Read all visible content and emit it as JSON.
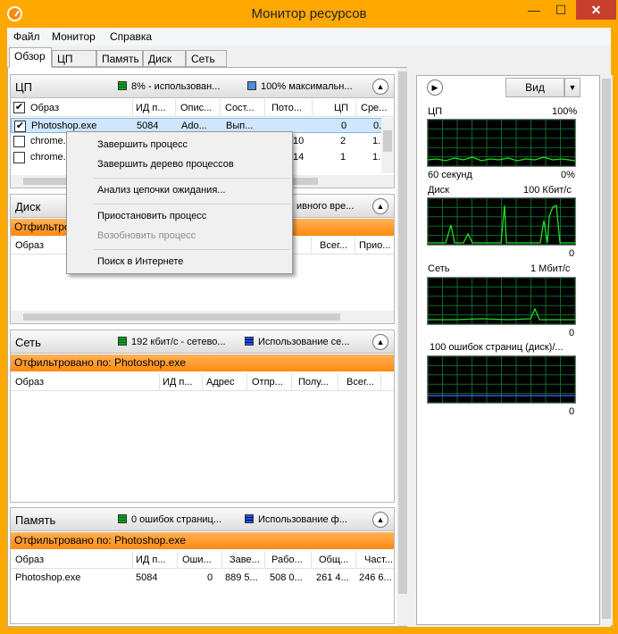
{
  "window": {
    "title": "Монитор ресурсов",
    "min_glyph": "—",
    "max_glyph": "☐",
    "close_glyph": "✕",
    "accent": "#ffa800"
  },
  "menu": [
    "Файл",
    "Монитор",
    "Справка"
  ],
  "tabs": [
    "Обзор",
    "ЦП",
    "Память",
    "Диск",
    "Сеть"
  ],
  "cpu_panel": {
    "title": "ЦП",
    "legend1": "8% - использован...",
    "legend2": "100% максимальн...",
    "columns": [
      "Образ",
      "ИД п...",
      "Опис...",
      "Сост...",
      "Пото...",
      "ЦП",
      "Сре..."
    ],
    "rows": [
      {
        "image": "Photoshop.exe",
        "pid": "5084",
        "desc": "Ado...",
        "status": "Вып...",
        "threads": "",
        "cpu": "0",
        "avg": "0...",
        "checked": true
      },
      {
        "image": "chrome.",
        "pid": "",
        "desc": "",
        "status": "",
        "threads": "10",
        "cpu": "2",
        "avg": "1.",
        "checked": false
      },
      {
        "image": "chrome.",
        "pid": "",
        "desc": "",
        "status": "",
        "threads": "14",
        "cpu": "1",
        "avg": "1.",
        "checked": false
      }
    ],
    "check_glyph": "✔"
  },
  "disk_panel": {
    "title": "Диск",
    "legend2": "ивного вре...",
    "filter": "Отфильтро",
    "columns": [
      "Образ",
      "Всег...",
      "Прио..."
    ]
  },
  "net_panel": {
    "title": "Сеть",
    "legend1": "192 кбит/с - сетево...",
    "legend2": "Использование се...",
    "filter": "Отфильтровано по: Photoshop.exe",
    "columns": [
      "Образ",
      "ИД п...",
      "Адрес",
      "Отпр...",
      "Полу...",
      "Всег..."
    ]
  },
  "mem_panel": {
    "title": "Память",
    "legend1": "0 ошибок страниц...",
    "legend2": "Использование ф...",
    "filter": "Отфильтровано по: Photoshop.exe",
    "columns": [
      "Образ",
      "ИД п...",
      "Оши...",
      "Заве...",
      "Рабо...",
      "Общ...",
      "Част..."
    ],
    "rows": [
      {
        "image": "Photoshop.exe",
        "pid": "5084",
        "faults": "0",
        "commit": "889 5...",
        "working": "508 0...",
        "shareable": "261 4...",
        "private": "246 6..."
      }
    ]
  },
  "context_menu": {
    "items": [
      {
        "label": "Завершить процесс",
        "disabled": false
      },
      {
        "label": "Завершить дерево процессов",
        "disabled": false
      },
      {
        "label": "Анализ цепочки ожидания...",
        "disabled": false
      },
      {
        "label": "Приостановить процесс",
        "disabled": false
      },
      {
        "label": "Возобновить процесс",
        "disabled": true
      },
      {
        "label": "Поиск в Интернете",
        "disabled": false
      }
    ]
  },
  "right_panel": {
    "view_label": "Вид",
    "graphs": [
      {
        "title": "ЦП",
        "max": "100%",
        "left_bottom": "60 секунд",
        "right_bottom": "0%"
      },
      {
        "title": "Диск",
        "max": "100 Кбит/с",
        "left_bottom": "",
        "right_bottom": "0"
      },
      {
        "title": "Сеть",
        "max": "1 Мбит/с",
        "left_bottom": "",
        "right_bottom": "0"
      },
      {
        "title": "100 ошибок страниц (диск)/...",
        "max": "",
        "left_bottom": "",
        "right_bottom": "0"
      }
    ]
  },
  "colors": {
    "graph_green": "#22dd22",
    "graph_blue": "#3a6cff",
    "filter_orange": "#ff9a20",
    "close_red": "#c7402f"
  }
}
